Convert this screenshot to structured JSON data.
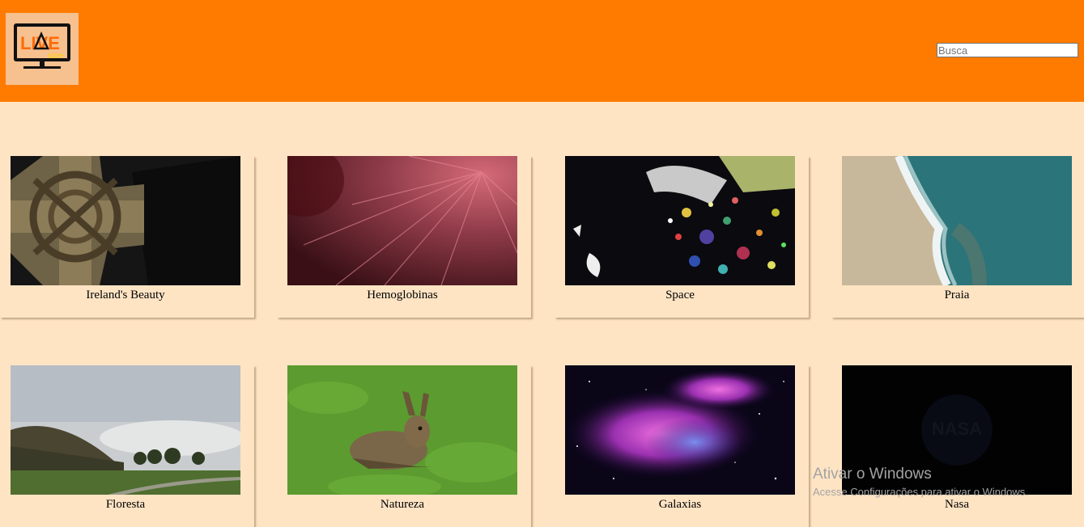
{
  "header": {
    "logo_text": "LIVE",
    "logo_sub": "tube",
    "search_placeholder": "Busca"
  },
  "videos": [
    {
      "title": "Ireland's Beauty"
    },
    {
      "title": "Hemoglobinas"
    },
    {
      "title": "Space"
    },
    {
      "title": "Praia"
    },
    {
      "title": "Floresta"
    },
    {
      "title": "Natureza"
    },
    {
      "title": "Galaxias"
    },
    {
      "title": "Nasa"
    }
  ],
  "thumb_art": {
    "nasa_text": "NASA"
  },
  "watermark": {
    "title": "Ativar o Windows",
    "subtitle": "Acesse Configurações para ativar o Windows."
  },
  "colors": {
    "header": "#ff7b00",
    "background": "#ffe4c4"
  }
}
